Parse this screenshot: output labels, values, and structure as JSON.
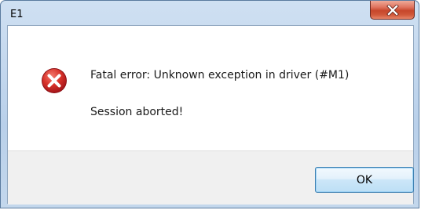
{
  "window": {
    "title": "E1"
  },
  "titlebar": {
    "close_icon": "close-icon"
  },
  "dialog": {
    "icon": "error-icon",
    "message": "Fatal error: Unknown exception in driver (#M1)",
    "detail": "Session aborted!"
  },
  "buttons": {
    "ok_label": "OK"
  },
  "colors": {
    "close_button": "#c7462b",
    "error_icon": "#c81f1f",
    "ok_button_border": "#3c7fb1"
  }
}
